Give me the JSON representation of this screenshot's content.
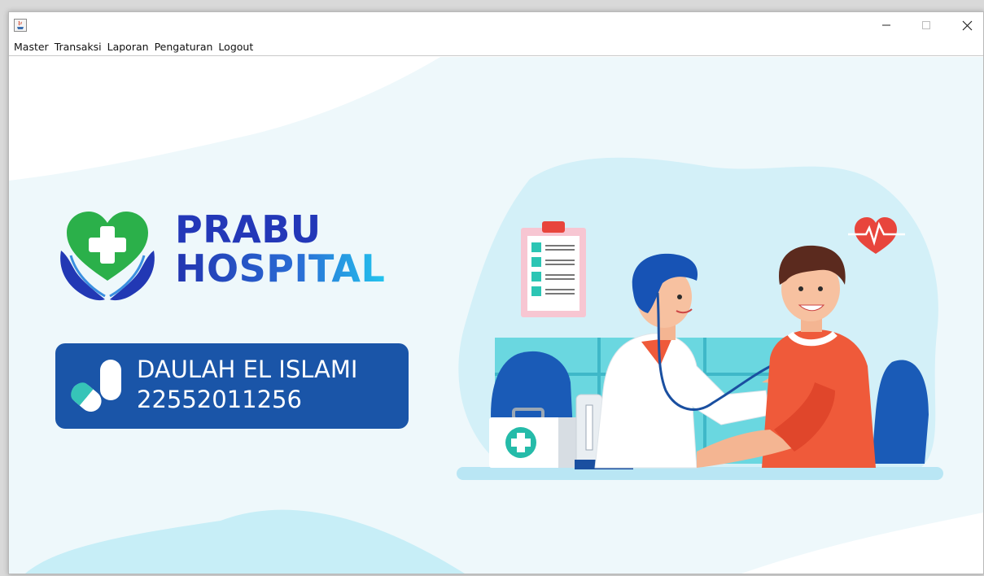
{
  "window": {
    "controls": {
      "minimize_icon": "minimize-icon",
      "maximize_icon": "maximize-icon",
      "close_icon": "close-icon"
    }
  },
  "menubar": {
    "items": [
      {
        "label": "Master"
      },
      {
        "label": "Transaksi"
      },
      {
        "label": "Laporan"
      },
      {
        "label": "Pengaturan"
      },
      {
        "label": "Logout"
      }
    ]
  },
  "brand": {
    "line1": "PRABU",
    "line2": "HOSPITAL",
    "logo_icon": "heart-cross-hands-icon"
  },
  "student_card": {
    "name": "DAULAH EL ISLAMI",
    "nim": "22552011256",
    "icon": "pill-capsule-icon"
  },
  "illustration": {
    "semantic": "doctor-examining-patient-illustration"
  },
  "colors": {
    "brand_blue": "#2338b8",
    "card_blue": "#1a55a8",
    "heart_green": "#27b04a",
    "background": "#eef8fb"
  }
}
